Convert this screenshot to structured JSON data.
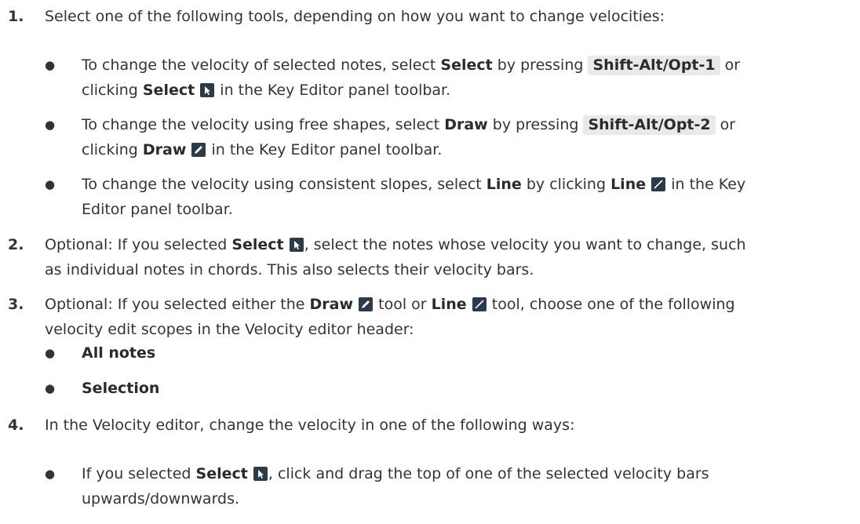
{
  "steps": [
    {
      "number": "1.",
      "text": "Select one of the following tools, depending on how you want to change velocities:",
      "bullets": [
        {
          "line1_a": "To change the velocity of selected notes, select ",
          "line1_b": "Select",
          "line1_c": " by pressing ",
          "line1_kbd": "Shift-Alt/Opt-1",
          "line1_d": " or",
          "line2_a": "clicking ",
          "line2_b": "Select",
          "line2_c": " in the Key Editor panel toolbar."
        },
        {
          "line1_a": "To change the velocity using free shapes, select ",
          "line1_b": "Draw",
          "line1_c": " by pressing ",
          "line1_kbd": "Shift-Alt/Opt-2",
          "line1_d": " or",
          "line2_a": "clicking ",
          "line2_b": "Draw",
          "line2_c": " in the Key Editor panel toolbar."
        },
        {
          "line1_a": "To change the velocity using consistent slopes, select ",
          "line1_b": "Line",
          "line1_c": " by clicking ",
          "line1_d": "Line",
          "line1_e": " in the Key",
          "line2_a": "Editor panel toolbar."
        }
      ]
    },
    {
      "number": "2.",
      "line1_a": "Optional: If you selected ",
      "line1_b": "Select",
      "line1_c": ", select the notes whose velocity you want to change, such",
      "line2_a": "as individual notes in chords. This also selects their velocity bars."
    },
    {
      "number": "3.",
      "line1_a": "Optional: If you selected either the ",
      "line1_b": "Draw",
      "line1_c": " tool or ",
      "line1_d": "Line",
      "line1_e": " tool, choose one of the following",
      "line2_a": "velocity edit scopes in the Velocity editor header:",
      "bullets": [
        "All notes",
        "Selection"
      ]
    },
    {
      "number": "4.",
      "text": "In the Velocity editor, change the velocity in one of the following ways:",
      "bullets": [
        {
          "line1_a": "If you selected ",
          "line1_b": "Select",
          "line1_c": ", click and drag the top of one of the selected velocity bars",
          "line2_a": "upwards/downwards."
        }
      ]
    }
  ],
  "bullet_glyph": "●",
  "icons": {
    "select": "select-tool-icon",
    "draw": "draw-tool-icon",
    "line": "line-tool-icon"
  },
  "colors": {
    "text": "#333333",
    "kbd_bg": "#e9e9e9",
    "icon_bg": "#2d3a4a"
  }
}
